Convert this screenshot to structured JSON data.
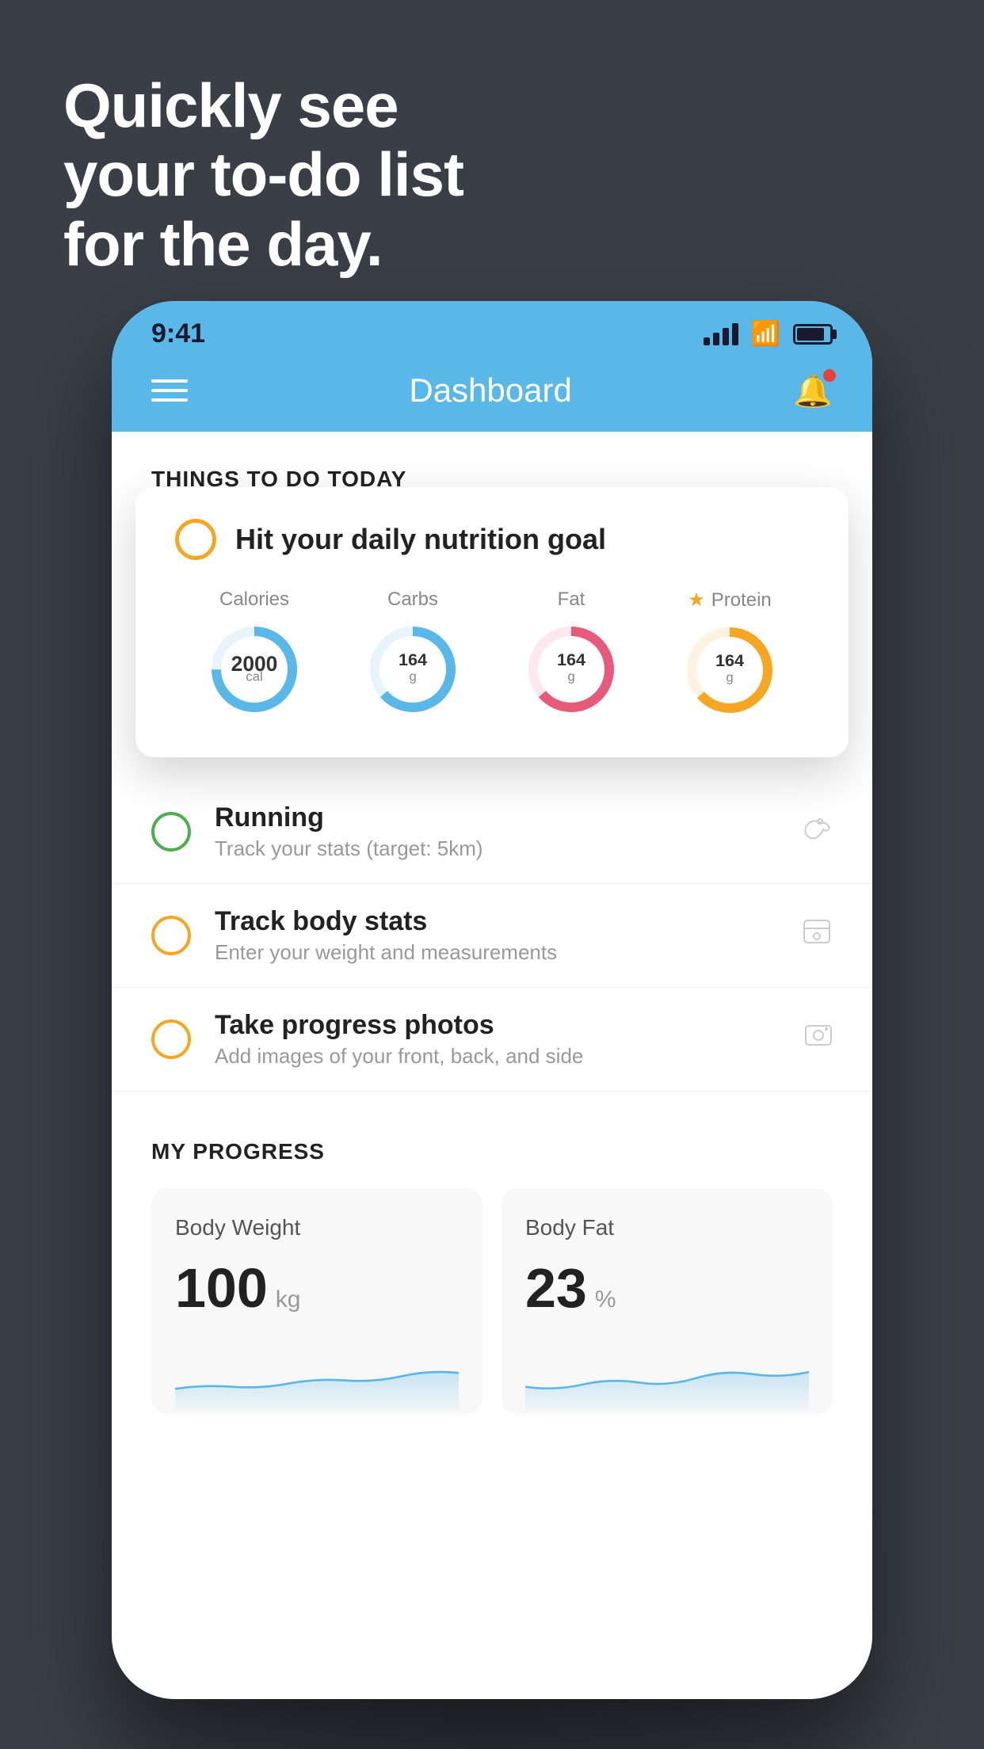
{
  "hero": {
    "line1": "Quickly see",
    "line2": "your to-do list",
    "line3": "for the day."
  },
  "statusBar": {
    "time": "9:41"
  },
  "navBar": {
    "title": "Dashboard"
  },
  "thingsSection": {
    "heading": "THINGS TO DO TODAY"
  },
  "nutritionCard": {
    "title": "Hit your daily nutrition goal",
    "circles": [
      {
        "label": "Calories",
        "value": "2000",
        "unit": "cal",
        "color": "#5ab8e8",
        "starred": false
      },
      {
        "label": "Carbs",
        "value": "164",
        "unit": "g",
        "color": "#5ab8e8",
        "starred": false
      },
      {
        "label": "Fat",
        "value": "164",
        "unit": "g",
        "color": "#e85a7a",
        "starred": false
      },
      {
        "label": "Protein",
        "value": "164",
        "unit": "g",
        "color": "#f5a623",
        "starred": true
      }
    ]
  },
  "todoItems": [
    {
      "title": "Running",
      "subtitle": "Track your stats (target: 5km)",
      "circleColor": "green",
      "icon": "👟"
    },
    {
      "title": "Track body stats",
      "subtitle": "Enter your weight and measurements",
      "circleColor": "yellow",
      "icon": "⚖"
    },
    {
      "title": "Take progress photos",
      "subtitle": "Add images of your front, back, and side",
      "circleColor": "yellow",
      "icon": "🖼"
    }
  ],
  "progressSection": {
    "heading": "MY PROGRESS",
    "cards": [
      {
        "title": "Body Weight",
        "value": "100",
        "unit": "kg"
      },
      {
        "title": "Body Fat",
        "value": "23",
        "unit": "%"
      }
    ]
  }
}
